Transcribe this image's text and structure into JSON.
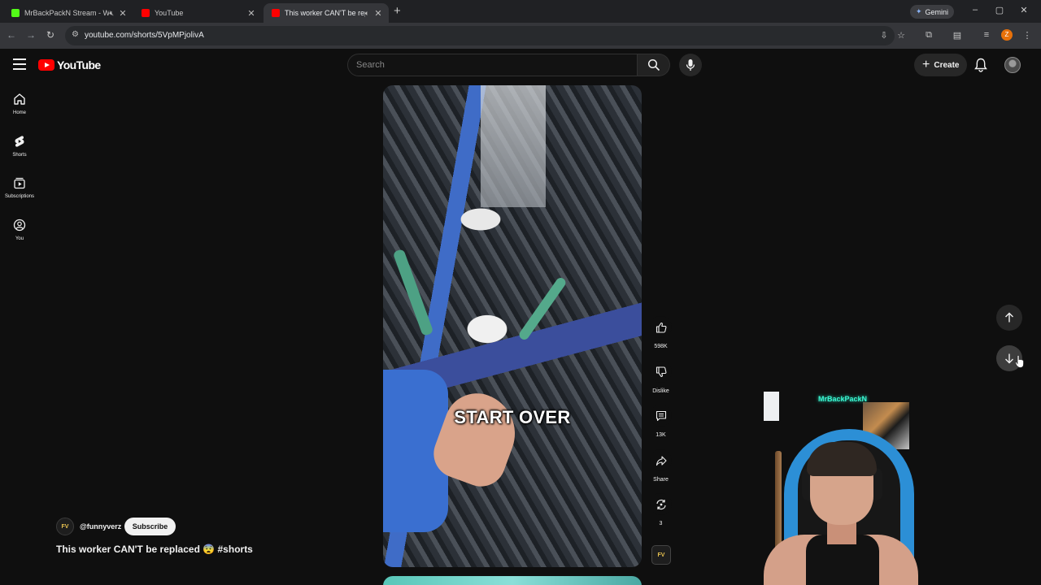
{
  "browser": {
    "tabs": [
      {
        "title": "MrBackPackN Stream - Wa",
        "favicon_color": "#53fc18",
        "muted": true,
        "active": false
      },
      {
        "title": "YouTube",
        "favicon_color": "#ff0000",
        "muted": false,
        "active": false
      },
      {
        "title": "This worker CAN'T be replac",
        "favicon_color": "#ff0000",
        "muted": true,
        "active": true
      }
    ],
    "url": "youtube.com/shorts/5VpMPjolivA",
    "gemini_label": "Gemini",
    "profile_initial": "Z"
  },
  "masthead": {
    "logo_text": "YouTube",
    "search_placeholder": "Search",
    "create_label": "Create"
  },
  "rail": [
    {
      "label": "Home",
      "icon": "home-icon"
    },
    {
      "label": "Shorts",
      "icon": "shorts-icon"
    },
    {
      "label": "Subscriptions",
      "icon": "subscriptions-icon"
    },
    {
      "label": "You",
      "icon": "you-icon"
    }
  ],
  "short": {
    "caption": "START OVER",
    "channel_handle": "@funnyverz",
    "channel_avatar_text": "FV",
    "subscribe_label": "Subscribe",
    "title": "This worker CAN'T be replaced 😨 #shorts",
    "actions": {
      "like_count": "598K",
      "dislike_label": "Dislike",
      "comment_count": "13K",
      "share_label": "Share",
      "remix_count": "3"
    }
  },
  "overlay": {
    "neon_sign": "MrBackPackN"
  },
  "colors": {
    "background": "#0f0f0f",
    "accent_red": "#ff0000",
    "chrome_dark": "#202124",
    "chrome_toolbar": "#35363a"
  }
}
